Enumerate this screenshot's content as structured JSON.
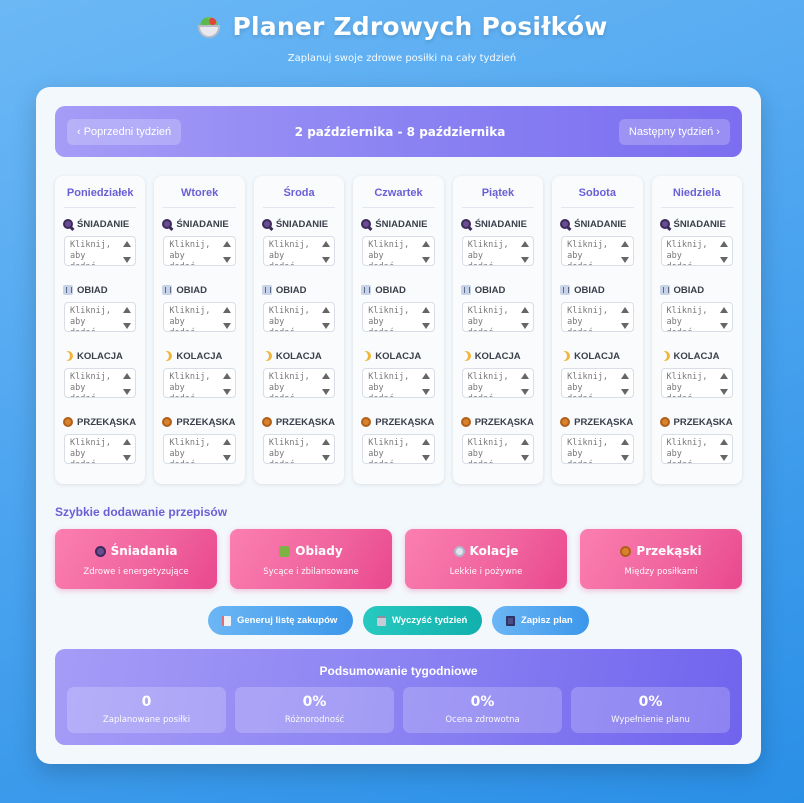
{
  "header": {
    "title": "Planer Zdrowych Posiłków",
    "subtitle": "Zaplanuj swoje zdrowe posiłki na cały tydzień"
  },
  "week_nav": {
    "prev_label": "‹ Poprzedni tydzień",
    "week_label": "2 października - 8 października",
    "next_label": "Następny tydzień ›"
  },
  "meal_types": [
    {
      "label": "ŚNIADANIE",
      "icon": "breakfast-icon"
    },
    {
      "label": "OBIAD",
      "icon": "lunch-icon"
    },
    {
      "label": "KOLACJA",
      "icon": "dinner-icon"
    },
    {
      "label": "PRZEKĄSKA",
      "icon": "snack-icon"
    }
  ],
  "meal_placeholder": "Kliknij, aby dodać...",
  "days": [
    {
      "name": "Poniedziałek"
    },
    {
      "name": "Wtorek"
    },
    {
      "name": "Środa"
    },
    {
      "name": "Czwartek"
    },
    {
      "name": "Piątek"
    },
    {
      "name": "Sobota"
    },
    {
      "name": "Niedziela"
    }
  ],
  "quick_add": {
    "title": "Szybkie dodawanie przepisów",
    "items": [
      {
        "label": "Śniadania",
        "sub": "Zdrowe i energetyzujące",
        "icon": "breakfast-icon"
      },
      {
        "label": "Obiady",
        "sub": "Sycące i zbilansowane",
        "icon": "lunch-icon"
      },
      {
        "label": "Kolacje",
        "sub": "Lekkie i pożywne",
        "icon": "dinner-icon"
      },
      {
        "label": "Przekąski",
        "sub": "Między posiłkami",
        "icon": "snack-icon"
      }
    ]
  },
  "actions": {
    "shopping": "Generuj listę zakupów",
    "clear": "Wyczyść tydzień",
    "save": "Zapisz plan"
  },
  "summary": {
    "title": "Podsumowanie tygodniowe",
    "stats": [
      {
        "value": "0",
        "label": "Zaplanowane posiłki"
      },
      {
        "value": "0%",
        "label": "Różnorodność"
      },
      {
        "value": "0%",
        "label": "Ocena zdrowotna"
      },
      {
        "value": "0%",
        "label": "Wypełnienie planu"
      }
    ]
  },
  "colors": {
    "accent_purple": "#6b5fd6",
    "nav_gradient_start": "#a59cf7",
    "nav_gradient_end": "#7b6ef0",
    "quick_pink": "#f0639e",
    "action_blue": "#3c97ea",
    "action_teal": "#12b0ad",
    "background_blue": "#4aa3ef"
  }
}
